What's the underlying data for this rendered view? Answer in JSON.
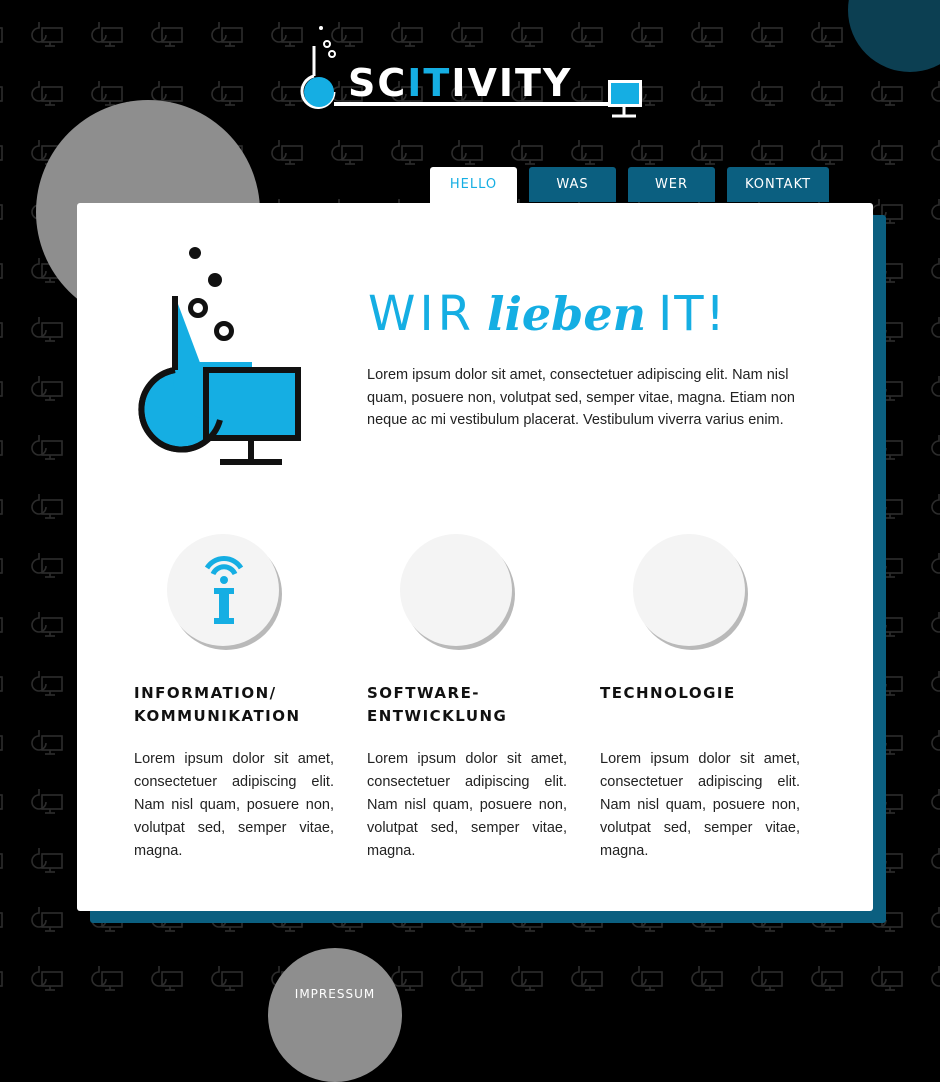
{
  "logo": {
    "prefix": "SC",
    "highlight": "IT",
    "suffix": "IVITY"
  },
  "nav": {
    "tabs": [
      {
        "label": "HELLO",
        "active": true
      },
      {
        "label": "WAS",
        "active": false
      },
      {
        "label": "WER",
        "active": false
      },
      {
        "label": "KONTAKT",
        "active": false
      }
    ]
  },
  "hero": {
    "title_part1": "WIR",
    "title_part2": "lieben",
    "title_part3": "IT!",
    "text": "Lorem ipsum dolor sit amet, consectetuer adipiscing elit. Nam nisl quam, posuere non, volutpat sed, semper vitae, magna. Etiam non neque ac mi vestibulum placerat. Vestibulum viverra varius enim."
  },
  "features": [
    {
      "title_line1": "INFORMATION/",
      "title_line2": "KOMMUNIKATION",
      "icon": "info-wifi-icon",
      "text": "Lorem ipsum dolor sit amet, consectetuer adipiscing elit. Nam nisl quam, posuere non, volutpat sed, semper vitae, magna."
    },
    {
      "title_line1": "SOFTWARE-",
      "title_line2": "ENTWICKLUNG",
      "icon": "",
      "text": "Lorem ipsum dolor sit amet, consectetuer adipiscing elit. Nam nisl quam, posuere non, volutpat sed, semper vitae, magna."
    },
    {
      "title_line1": "TECHNOLOGIE",
      "title_line2": "",
      "icon": "",
      "text": "Lorem ipsum dolor sit amet, consectetuer adipiscing elit. Nam nisl quam, posuere non, volutpat sed, semper vitae, magna."
    }
  ],
  "footer": {
    "impressum": "IMPRESSUM"
  },
  "colors": {
    "accent": "#15aee3",
    "nav_tab": "#0b5f80",
    "background": "#000000",
    "card": "#ffffff",
    "grey_circle": "#8e8e8e"
  }
}
